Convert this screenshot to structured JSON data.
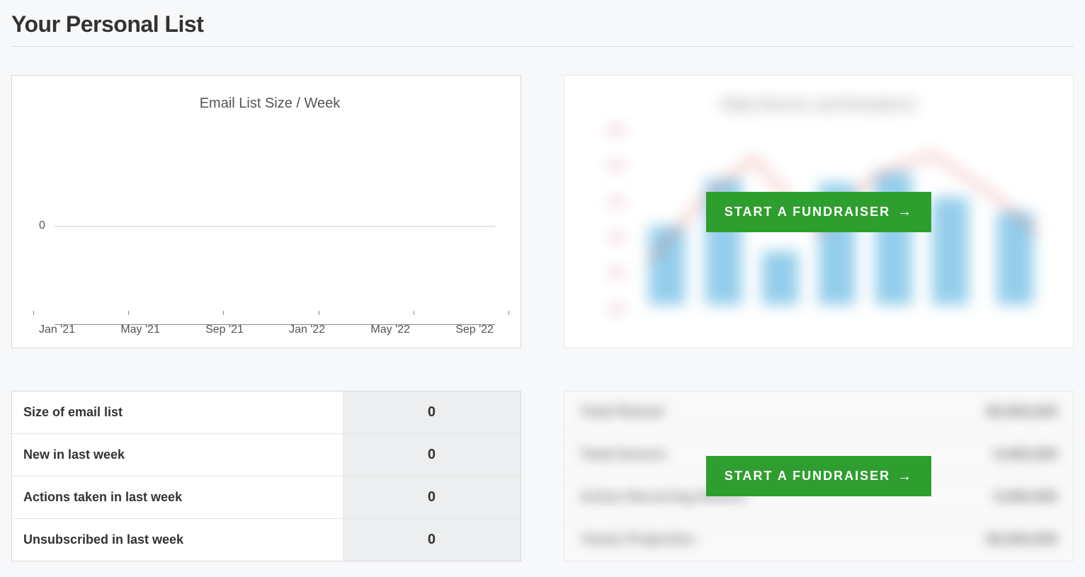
{
  "page": {
    "title": "Your Personal List"
  },
  "email_chart": {
    "title": "Email List Size / Week",
    "y_ticks": [
      "0"
    ],
    "x_ticks": [
      "Jan '21",
      "May '21",
      "Sep '21",
      "Jan '22",
      "May '22",
      "Sep '22"
    ]
  },
  "chart_data": {
    "type": "line",
    "title": "Email List Size / Week",
    "xlabel": "",
    "ylabel": "",
    "categories": [
      "Jan '21",
      "May '21",
      "Sep '21",
      "Jan '22",
      "May '22",
      "Sep '22"
    ],
    "series": [
      {
        "name": "Email List Size",
        "values": [
          0,
          0,
          0,
          0,
          0,
          0
        ]
      }
    ],
    "ylim": [
      0,
      0
    ]
  },
  "cta": {
    "label": "START A FUNDRAISER",
    "arrow": "→"
  },
  "stats": [
    {
      "label": "Size of email list",
      "value": "0"
    },
    {
      "label": "New in last week",
      "value": "0"
    },
    {
      "label": "Actions taken in last week",
      "value": "0"
    },
    {
      "label": "Unsubscribed in last week",
      "value": "0"
    }
  ],
  "blurred_stats_placeholder": [
    {
      "label": "Total Raised",
      "value": "$0,000,000"
    },
    {
      "label": "Total Donors",
      "value": "0,000,000"
    },
    {
      "label": "Active Recurring Donors",
      "value": "0,000,000"
    },
    {
      "label": "Yearly Projection",
      "value": "$0,000,000"
    }
  ],
  "blurred_chart_placeholder_title": "Daily Donors and Donations"
}
